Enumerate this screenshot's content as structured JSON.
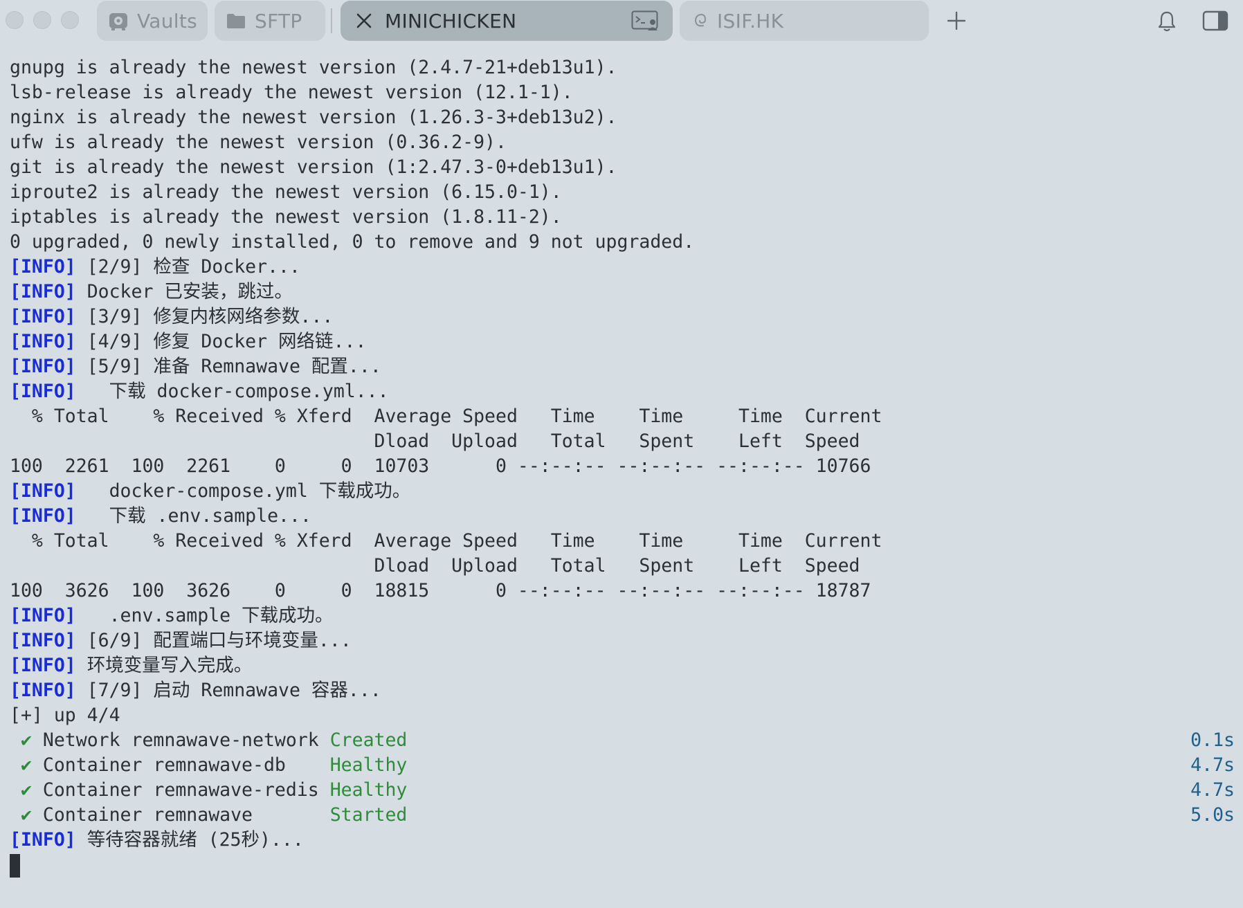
{
  "tabs": [
    {
      "label": "Vaults",
      "icon": "vault-icon"
    },
    {
      "label": "SFTP",
      "icon": "folder-icon"
    },
    {
      "label": "MINICHICKEN",
      "icon": "close-icon",
      "active": true
    },
    {
      "label": "ISIF.HK",
      "icon": "debian-icon"
    }
  ],
  "toolbar": {
    "new_tab": "+",
    "bell": "bell-icon",
    "sidebar": "sidebar-toggle-icon"
  },
  "terminal": {
    "lines": [
      {
        "text": "gnupg is already the newest version (2.4.7-21+deb13u1)."
      },
      {
        "text": "lsb-release is already the newest version (12.1-1)."
      },
      {
        "text": "nginx is already the newest version (1.26.3-3+deb13u2)."
      },
      {
        "text": "ufw is already the newest version (0.36.2-9)."
      },
      {
        "text": "git is already the newest version (1:2.47.3-0+deb13u1)."
      },
      {
        "text": "iproute2 is already the newest version (6.15.0-1)."
      },
      {
        "text": "iptables is already the newest version (1.8.11-2)."
      },
      {
        "text": "0 upgraded, 0 newly installed, 0 to remove and 9 not upgraded."
      },
      {
        "tag": "[INFO]",
        "text": " [2/9] 检查 Docker..."
      },
      {
        "tag": "[INFO]",
        "text": " Docker 已安装，跳过。"
      },
      {
        "tag": "[INFO]",
        "text": " [3/9] 修复内核网络参数..."
      },
      {
        "tag": "[INFO]",
        "text": " [4/9] 修复 Docker 网络链..."
      },
      {
        "tag": "[INFO]",
        "text": " [5/9] 准备 Remnawave 配置..."
      },
      {
        "tag": "[INFO]",
        "text": "   下载 docker-compose.yml..."
      },
      {
        "text": "  % Total    % Received % Xferd  Average Speed   Time    Time     Time  Current"
      },
      {
        "text": "                                 Dload  Upload   Total   Spent    Left  Speed"
      },
      {
        "text": "100  2261  100  2261    0     0  10703      0 --:--:-- --:--:-- --:--:-- 10766"
      },
      {
        "tag": "[INFO]",
        "text": "   docker-compose.yml 下载成功。"
      },
      {
        "tag": "[INFO]",
        "text": "   下载 .env.sample..."
      },
      {
        "text": "  % Total    % Received % Xferd  Average Speed   Time    Time     Time  Current"
      },
      {
        "text": "                                 Dload  Upload   Total   Spent    Left  Speed"
      },
      {
        "text": "100  3626  100  3626    0     0  18815      0 --:--:-- --:--:-- --:--:-- 18787"
      },
      {
        "tag": "[INFO]",
        "text": "   .env.sample 下载成功。"
      },
      {
        "tag": "[INFO]",
        "text": " [6/9] 配置端口与环境变量..."
      },
      {
        "tag": "[INFO]",
        "text": " 环境变量写入完成。"
      },
      {
        "tag": "[INFO]",
        "text": " [7/9] 启动 Remnawave 容器..."
      },
      {
        "text": "[+] up 4/4"
      },
      {
        "check": " ✔",
        "text": " Network remnawave-network ",
        "status": "Created",
        "time": "0.1s"
      },
      {
        "check": " ✔",
        "text": " Container remnawave-db    ",
        "status": "Healthy",
        "time": "4.7s"
      },
      {
        "check": " ✔",
        "text": " Container remnawave-redis ",
        "status": "Healthy",
        "time": "4.7s"
      },
      {
        "check": " ✔",
        "text": " Container remnawave       ",
        "status": "Started",
        "time": "5.0s"
      },
      {
        "tag": "[INFO]",
        "text": " 等待容器就绪 (25秒)..."
      }
    ]
  },
  "colors": {
    "background": "#d6dee3",
    "info": "#1a2cd6",
    "status_green": "#2e8b3a",
    "time_blue": "#1f5f8c"
  }
}
